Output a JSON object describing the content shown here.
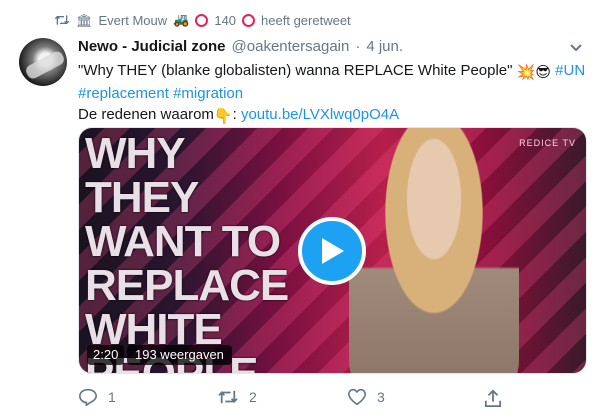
{
  "retweet": {
    "user": "Evert Mouw",
    "count_text": "140",
    "suffix": "heeft geretweet"
  },
  "tweet": {
    "name": "Newo - Judicial zone",
    "handle": "@oakentersagain",
    "separator": "·",
    "date": "4 jun.",
    "line1_text": "\"Why THEY (blanke globalisten) wanna REPLACE White People\"",
    "hashtag_un": "#UN",
    "hashtag_replacement": "#replacement",
    "hashtag_migration": "#migration",
    "line3_text": "De redenen waarom",
    "colon": ":",
    "link": "youtu.be/LVXlwq0pO4A"
  },
  "media": {
    "overlay_text": "WHY\nTHEY\nWANT TO\nREPLACE\nWHITE\nPEOPLE",
    "badge": "REDICE TV",
    "duration": "2:20",
    "views": "193 weergaven"
  },
  "actions": {
    "replies": "1",
    "retweets": "2",
    "likes": "3"
  },
  "colors": {
    "accent": "#1da1f2",
    "link": "#1b95e0",
    "muted": "#657786",
    "ring": "#e0245e"
  },
  "icons": [
    "retweet-icon",
    "bank-icon",
    "tractor-icon",
    "ring-icon",
    "chevron-down-icon",
    "explosion-emoji",
    "sunglasses-emoji",
    "point-down-emoji",
    "play-icon",
    "reply-icon",
    "like-icon",
    "share-icon"
  ]
}
